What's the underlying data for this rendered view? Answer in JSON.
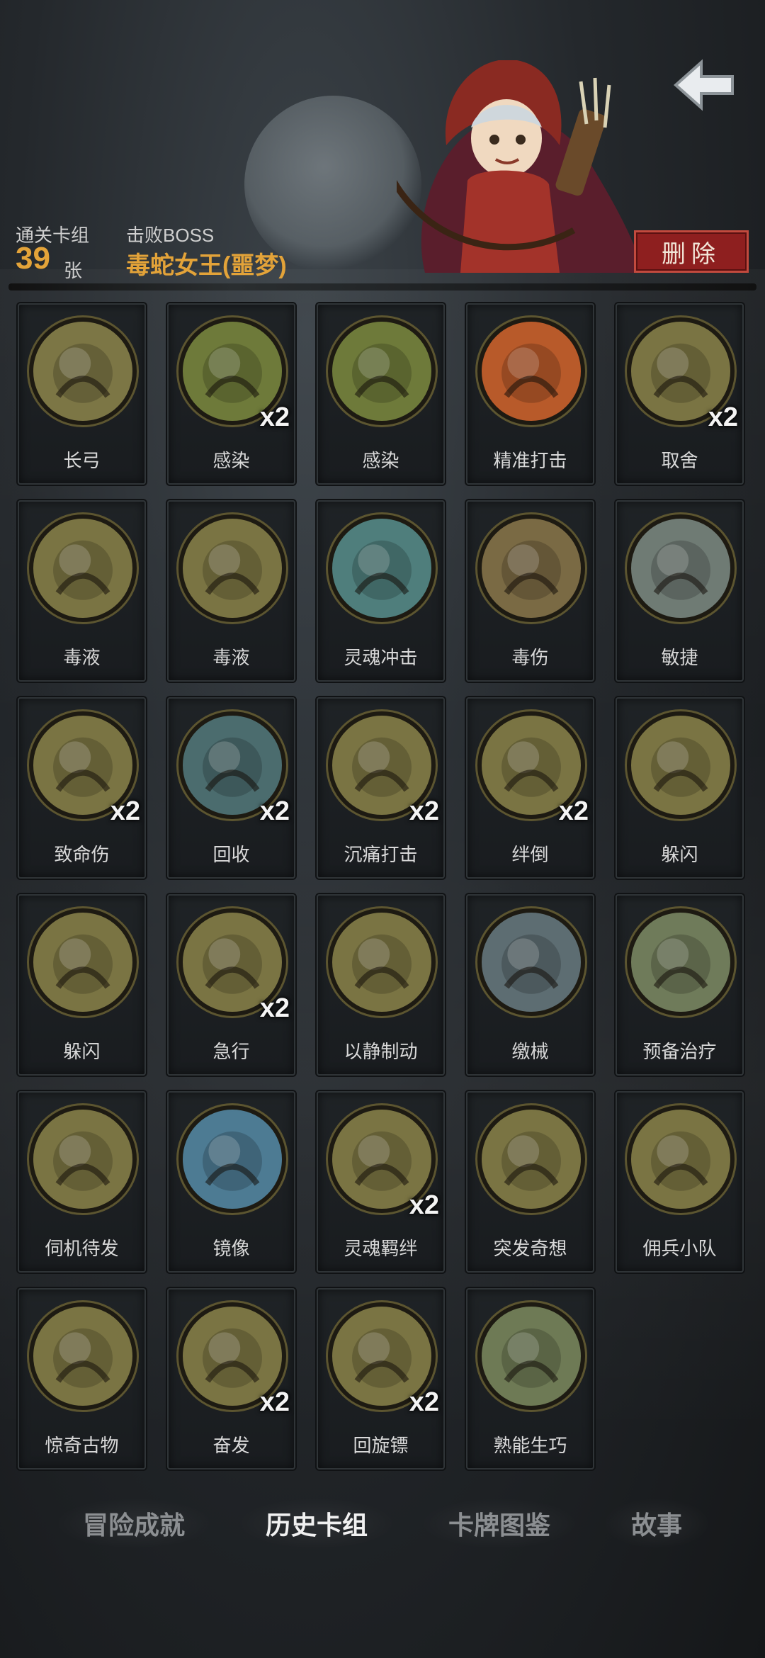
{
  "header": {
    "cleared_decks_label": "通关卡组",
    "cleared_decks_count": "39",
    "cleared_decks_unit": "张",
    "defeated_boss_label": "击败BOSS",
    "defeated_boss_name": "毒蛇女王(噩梦)",
    "delete_label": "删除",
    "back_icon": "back-arrow-icon"
  },
  "colors": {
    "accent_gold": "#e3a339",
    "delete_red": "#8e1f1f",
    "card_art_bg": "#7a7443"
  },
  "cards": [
    {
      "name": "长弓",
      "count": "",
      "icon": "longbow-icon",
      "art": "#7c7645"
    },
    {
      "name": "感染",
      "count": "x2",
      "icon": "infection-icon",
      "art": "#6e7a3a"
    },
    {
      "name": "感染",
      "count": "",
      "icon": "infection-icon",
      "art": "#6e7a3a"
    },
    {
      "name": "精准打击",
      "count": "",
      "icon": "target-icon",
      "art": "#b85a2a"
    },
    {
      "name": "取舍",
      "count": "x2",
      "icon": "priest-icon",
      "art": "#7a7443"
    },
    {
      "name": "毒液",
      "count": "",
      "icon": "venom-icon",
      "art": "#7a7443"
    },
    {
      "name": "毒液",
      "count": "",
      "icon": "venom-icon",
      "art": "#7a7443"
    },
    {
      "name": "灵魂冲击",
      "count": "",
      "icon": "soul-strike-icon",
      "art": "#4f7e7c"
    },
    {
      "name": "毒伤",
      "count": "",
      "icon": "poison-wound-icon",
      "art": "#7a6a44"
    },
    {
      "name": "敏捷",
      "count": "",
      "icon": "panther-icon",
      "art": "#6f7b74"
    },
    {
      "name": "致命伤",
      "count": "x2",
      "icon": "fatal-wound-icon",
      "art": "#7a7443"
    },
    {
      "name": "回收",
      "count": "x2",
      "icon": "recycle-icon",
      "art": "#4b6c6e"
    },
    {
      "name": "沉痛打击",
      "count": "x2",
      "icon": "heavy-blow-icon",
      "art": "#7a7443"
    },
    {
      "name": "绊倒",
      "count": "x2",
      "icon": "trip-icon",
      "art": "#7a7443"
    },
    {
      "name": "躲闪",
      "count": "",
      "icon": "dodge-icon",
      "art": "#7a7443"
    },
    {
      "name": "躲闪",
      "count": "",
      "icon": "dodge-icon",
      "art": "#7a7443"
    },
    {
      "name": "急行",
      "count": "x2",
      "icon": "dash-icon",
      "art": "#7a7443"
    },
    {
      "name": "以静制动",
      "count": "",
      "icon": "skull-icon",
      "art": "#7a7443"
    },
    {
      "name": "缴械",
      "count": "",
      "icon": "disarm-icon",
      "art": "#5d6d72"
    },
    {
      "name": "预备治疗",
      "count": "",
      "icon": "heart-heal-icon",
      "art": "#6f7b5a"
    },
    {
      "name": "伺机待发",
      "count": "",
      "icon": "ambush-icon",
      "art": "#7a7443"
    },
    {
      "name": "镜像",
      "count": "",
      "icon": "mirror-icon",
      "art": "#4d7b93"
    },
    {
      "name": "灵魂羁绊",
      "count": "x2",
      "icon": "soul-bond-icon",
      "art": "#7a7443"
    },
    {
      "name": "突发奇想",
      "count": "",
      "icon": "idea-icon",
      "art": "#7a7443"
    },
    {
      "name": "佣兵小队",
      "count": "",
      "icon": "mercenary-icon",
      "art": "#7a7443"
    },
    {
      "name": "惊奇古物",
      "count": "",
      "icon": "antique-icon",
      "art": "#7a7443"
    },
    {
      "name": "奋发",
      "count": "x2",
      "icon": "dumbbell-icon",
      "art": "#7a7443"
    },
    {
      "name": "回旋镖",
      "count": "x2",
      "icon": "boomerang-icon",
      "art": "#7a7443"
    },
    {
      "name": "熟能生巧",
      "count": "",
      "icon": "practice-icon",
      "art": "#6e7a55"
    }
  ],
  "tabs": [
    {
      "label": "冒险成就",
      "active": false
    },
    {
      "label": "历史卡组",
      "active": true
    },
    {
      "label": "卡牌图鉴",
      "active": false
    },
    {
      "label": "故事",
      "active": false
    }
  ]
}
